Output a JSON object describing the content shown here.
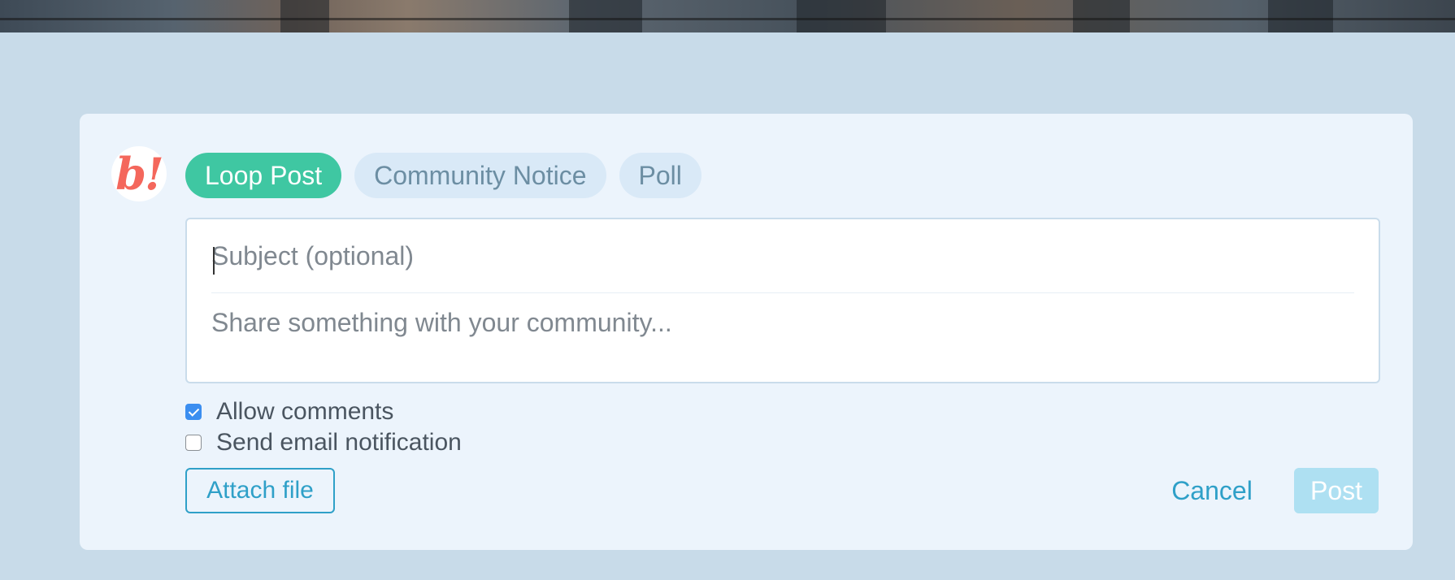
{
  "logo": {
    "text": "b!",
    "color": "#f4675c"
  },
  "tabs": [
    {
      "label": "Loop Post",
      "active": true
    },
    {
      "label": "Community Notice",
      "active": false
    },
    {
      "label": "Poll",
      "active": false
    }
  ],
  "composer": {
    "subject_placeholder": "Subject (optional)",
    "body_placeholder": "Share something with your community..."
  },
  "options": {
    "allow_comments": {
      "label": "Allow comments",
      "checked": true
    },
    "send_email": {
      "label": "Send email notification",
      "checked": false
    }
  },
  "actions": {
    "attach_label": "Attach file",
    "cancel_label": "Cancel",
    "post_label": "Post"
  },
  "colors": {
    "background": "#c8dbe9",
    "card": "#ecf4fc",
    "accent": "#3fc7a2",
    "link": "#2fa0c8",
    "post_disabled": "#aee0f2"
  }
}
